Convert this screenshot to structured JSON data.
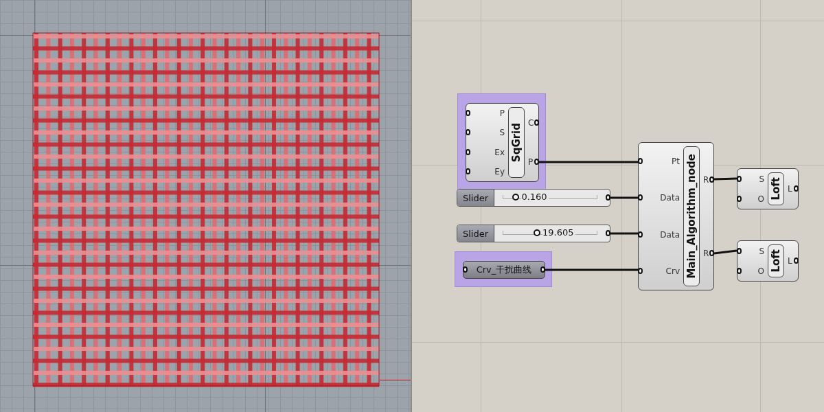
{
  "canvas": {
    "nodes": [
      {
        "kind": "component",
        "name": "SqGrid",
        "inputs": [
          "P",
          "S",
          "Ex",
          "Ey"
        ],
        "outputs": [
          "C",
          "P"
        ],
        "grouped": true
      },
      {
        "kind": "slider",
        "label": "Slider",
        "value": "0.160",
        "level": 0.16
      },
      {
        "kind": "slider",
        "label": "Slider",
        "value": "19.605",
        "level": 0.37
      },
      {
        "kind": "param",
        "name": "Crv_干扰曲线",
        "grouped": true
      },
      {
        "kind": "component",
        "name": "Main_Algorithm_node",
        "inputs": [
          "Pt",
          "Data",
          "Data",
          "Crv"
        ],
        "outputs": [
          "R",
          "R"
        ],
        "grouped": false
      },
      {
        "kind": "component",
        "name": "Loft",
        "inputs": [
          "S",
          "O"
        ],
        "outputs": [
          "L"
        ],
        "grouped": false
      },
      {
        "kind": "component",
        "name": "Loft",
        "inputs": [
          "S",
          "O"
        ],
        "outputs": [
          "L"
        ],
        "grouped": false
      }
    ]
  }
}
